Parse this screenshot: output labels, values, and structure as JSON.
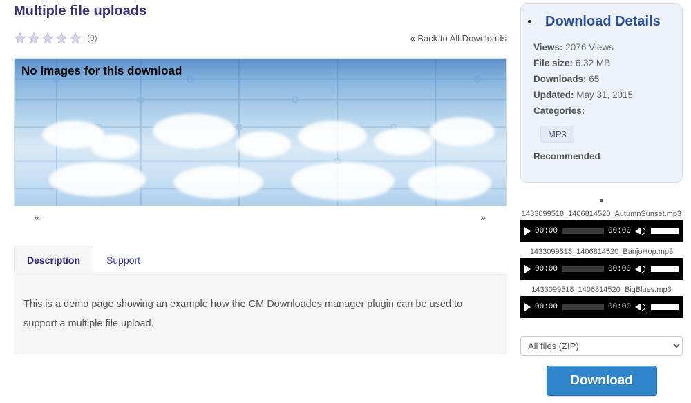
{
  "page": {
    "title": "Multiple file uploads",
    "rating_count": "(0)",
    "back_link": "« Back to All Downloads",
    "no_images_text": "No images for this download",
    "gallery_prev": "«",
    "gallery_next": "»"
  },
  "tabs": {
    "description_label": "Description",
    "support_label": "Support",
    "description_body": "This is a demo page showing an example how the CM Downloades manager plugin can be used to support a multiple file upload."
  },
  "details": {
    "heading": "Download Details",
    "views_label": "Views:",
    "views_value": "2076 Views",
    "filesize_label": "File size:",
    "filesize_value": "6.32 MB",
    "downloads_label": "Downloads:",
    "downloads_value": "65",
    "updated_label": "Updated:",
    "updated_value": "May 31, 2015",
    "categories_label": "Categories:",
    "category_badge": "MP3",
    "recommended_label": "Recommended"
  },
  "audio": {
    "items": [
      {
        "name": "1433099518_1406814520_AutumnSunset.mp3",
        "cur": "00:00",
        "dur": "00:00"
      },
      {
        "name": "1433099518_1406814520_BanjoHop.mp3",
        "cur": "00:00",
        "dur": "00:00"
      },
      {
        "name": "1433099518_1406814520_BigBlues.mp3",
        "cur": "00:00",
        "dur": "00:00"
      }
    ]
  },
  "download": {
    "select_label": "All files (ZIP)",
    "button_label": "Download"
  }
}
